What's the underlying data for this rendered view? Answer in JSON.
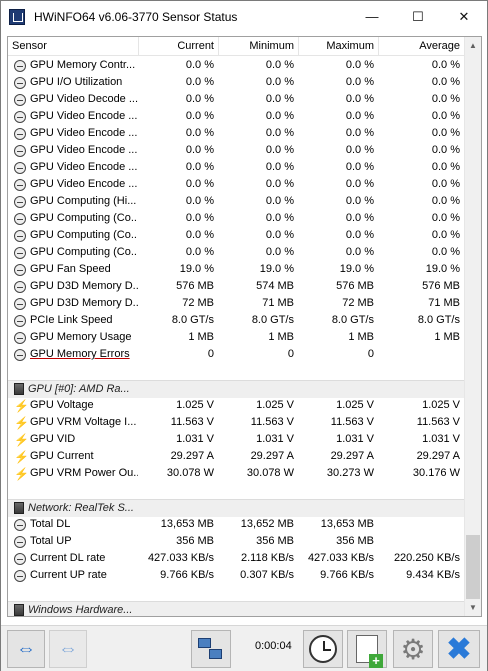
{
  "window": {
    "title": "HWiNFO64 v6.06-3770 Sensor Status",
    "minimize_icon": "—",
    "maximize_icon": "☐",
    "close_icon": "✕"
  },
  "columns": [
    "Sensor",
    "Current",
    "Minimum",
    "Maximum",
    "Average"
  ],
  "rows": [
    {
      "kind": "sensor",
      "icon": "gauge-icon",
      "name": "GPU Memory Contr...",
      "current": "0.0 %",
      "min": "0.0 %",
      "max": "0.0 %",
      "avg": "0.0 %"
    },
    {
      "kind": "sensor",
      "icon": "gauge-icon",
      "name": "GPU I/O Utilization",
      "current": "0.0 %",
      "min": "0.0 %",
      "max": "0.0 %",
      "avg": "0.0 %"
    },
    {
      "kind": "sensor",
      "icon": "gauge-icon",
      "name": "GPU Video Decode ...",
      "current": "0.0 %",
      "min": "0.0 %",
      "max": "0.0 %",
      "avg": "0.0 %"
    },
    {
      "kind": "sensor",
      "icon": "gauge-icon",
      "name": "GPU Video Encode ...",
      "current": "0.0 %",
      "min": "0.0 %",
      "max": "0.0 %",
      "avg": "0.0 %"
    },
    {
      "kind": "sensor",
      "icon": "gauge-icon",
      "name": "GPU Video Encode ...",
      "current": "0.0 %",
      "min": "0.0 %",
      "max": "0.0 %",
      "avg": "0.0 %"
    },
    {
      "kind": "sensor",
      "icon": "gauge-icon",
      "name": "GPU Video Encode ...",
      "current": "0.0 %",
      "min": "0.0 %",
      "max": "0.0 %",
      "avg": "0.0 %"
    },
    {
      "kind": "sensor",
      "icon": "gauge-icon",
      "name": "GPU Video Encode ...",
      "current": "0.0 %",
      "min": "0.0 %",
      "max": "0.0 %",
      "avg": "0.0 %"
    },
    {
      "kind": "sensor",
      "icon": "gauge-icon",
      "name": "GPU Video Encode ...",
      "current": "0.0 %",
      "min": "0.0 %",
      "max": "0.0 %",
      "avg": "0.0 %"
    },
    {
      "kind": "sensor",
      "icon": "gauge-icon",
      "name": "GPU Computing (Hi...",
      "current": "0.0 %",
      "min": "0.0 %",
      "max": "0.0 %",
      "avg": "0.0 %"
    },
    {
      "kind": "sensor",
      "icon": "gauge-icon",
      "name": "GPU Computing (Co...",
      "current": "0.0 %",
      "min": "0.0 %",
      "max": "0.0 %",
      "avg": "0.0 %"
    },
    {
      "kind": "sensor",
      "icon": "gauge-icon",
      "name": "GPU Computing (Co...",
      "current": "0.0 %",
      "min": "0.0 %",
      "max": "0.0 %",
      "avg": "0.0 %"
    },
    {
      "kind": "sensor",
      "icon": "gauge-icon",
      "name": "GPU Computing (Co...",
      "current": "0.0 %",
      "min": "0.0 %",
      "max": "0.0 %",
      "avg": "0.0 %"
    },
    {
      "kind": "sensor",
      "icon": "gauge-icon",
      "name": "GPU Fan Speed",
      "current": "19.0 %",
      "min": "19.0 %",
      "max": "19.0 %",
      "avg": "19.0 %"
    },
    {
      "kind": "sensor",
      "icon": "gauge-icon",
      "name": "GPU D3D Memory D...",
      "current": "576 MB",
      "min": "574 MB",
      "max": "576 MB",
      "avg": "576 MB"
    },
    {
      "kind": "sensor",
      "icon": "gauge-icon",
      "name": "GPU D3D Memory D...",
      "current": "72 MB",
      "min": "71 MB",
      "max": "72 MB",
      "avg": "71 MB"
    },
    {
      "kind": "sensor",
      "icon": "gauge-icon",
      "name": "PCIe Link Speed",
      "current": "8.0 GT/s",
      "min": "8.0 GT/s",
      "max": "8.0 GT/s",
      "avg": "8.0 GT/s"
    },
    {
      "kind": "sensor",
      "icon": "gauge-icon",
      "name": "GPU Memory Usage",
      "current": "1 MB",
      "min": "1 MB",
      "max": "1 MB",
      "avg": "1 MB"
    },
    {
      "kind": "sensor",
      "icon": "gauge-icon",
      "name": "GPU Memory Errors",
      "current": "0",
      "min": "0",
      "max": "0",
      "avg": "",
      "underline": true
    },
    {
      "kind": "blank"
    },
    {
      "kind": "group",
      "name": "GPU [#0]: AMD Ra..."
    },
    {
      "kind": "sensor",
      "icon": "bolt-icon",
      "name": "GPU Voltage",
      "current": "1.025 V",
      "min": "1.025 V",
      "max": "1.025 V",
      "avg": "1.025 V"
    },
    {
      "kind": "sensor",
      "icon": "bolt-icon",
      "name": "GPU VRM Voltage I...",
      "current": "11.563 V",
      "min": "11.563 V",
      "max": "11.563 V",
      "avg": "11.563 V"
    },
    {
      "kind": "sensor",
      "icon": "bolt-icon",
      "name": "GPU VID",
      "current": "1.031 V",
      "min": "1.031 V",
      "max": "1.031 V",
      "avg": "1.031 V"
    },
    {
      "kind": "sensor",
      "icon": "bolt-icon",
      "name": "GPU Current",
      "current": "29.297 A",
      "min": "29.297 A",
      "max": "29.297 A",
      "avg": "29.297 A"
    },
    {
      "kind": "sensor",
      "icon": "bolt-icon",
      "name": "GPU VRM Power Ou...",
      "current": "30.078 W",
      "min": "30.078 W",
      "max": "30.273 W",
      "avg": "30.176 W"
    },
    {
      "kind": "blank"
    },
    {
      "kind": "group",
      "name": "Network: RealTek S..."
    },
    {
      "kind": "sensor",
      "icon": "gauge-icon",
      "name": "Total DL",
      "current": "13,653 MB",
      "min": "13,652 MB",
      "max": "13,653 MB",
      "avg": ""
    },
    {
      "kind": "sensor",
      "icon": "gauge-icon",
      "name": "Total UP",
      "current": "356 MB",
      "min": "356 MB",
      "max": "356 MB",
      "avg": ""
    },
    {
      "kind": "sensor",
      "icon": "gauge-icon",
      "name": "Current DL rate",
      "current": "427.033 KB/s",
      "min": "2.118 KB/s",
      "max": "427.033 KB/s",
      "avg": "220.250 KB/s"
    },
    {
      "kind": "sensor",
      "icon": "gauge-icon",
      "name": "Current UP rate",
      "current": "9.766 KB/s",
      "min": "0.307 KB/s",
      "max": "9.766 KB/s",
      "avg": "9.434 KB/s"
    },
    {
      "kind": "blank"
    },
    {
      "kind": "group",
      "name": "Windows Hardware..."
    }
  ],
  "scrollbar": {
    "up_icon": "▲",
    "down_icon": "▼"
  },
  "toolbar": {
    "nav_icon": "⇔",
    "elapsed_time": "0:00:04",
    "gear_icon": "⚙",
    "close_icon": "✖"
  }
}
